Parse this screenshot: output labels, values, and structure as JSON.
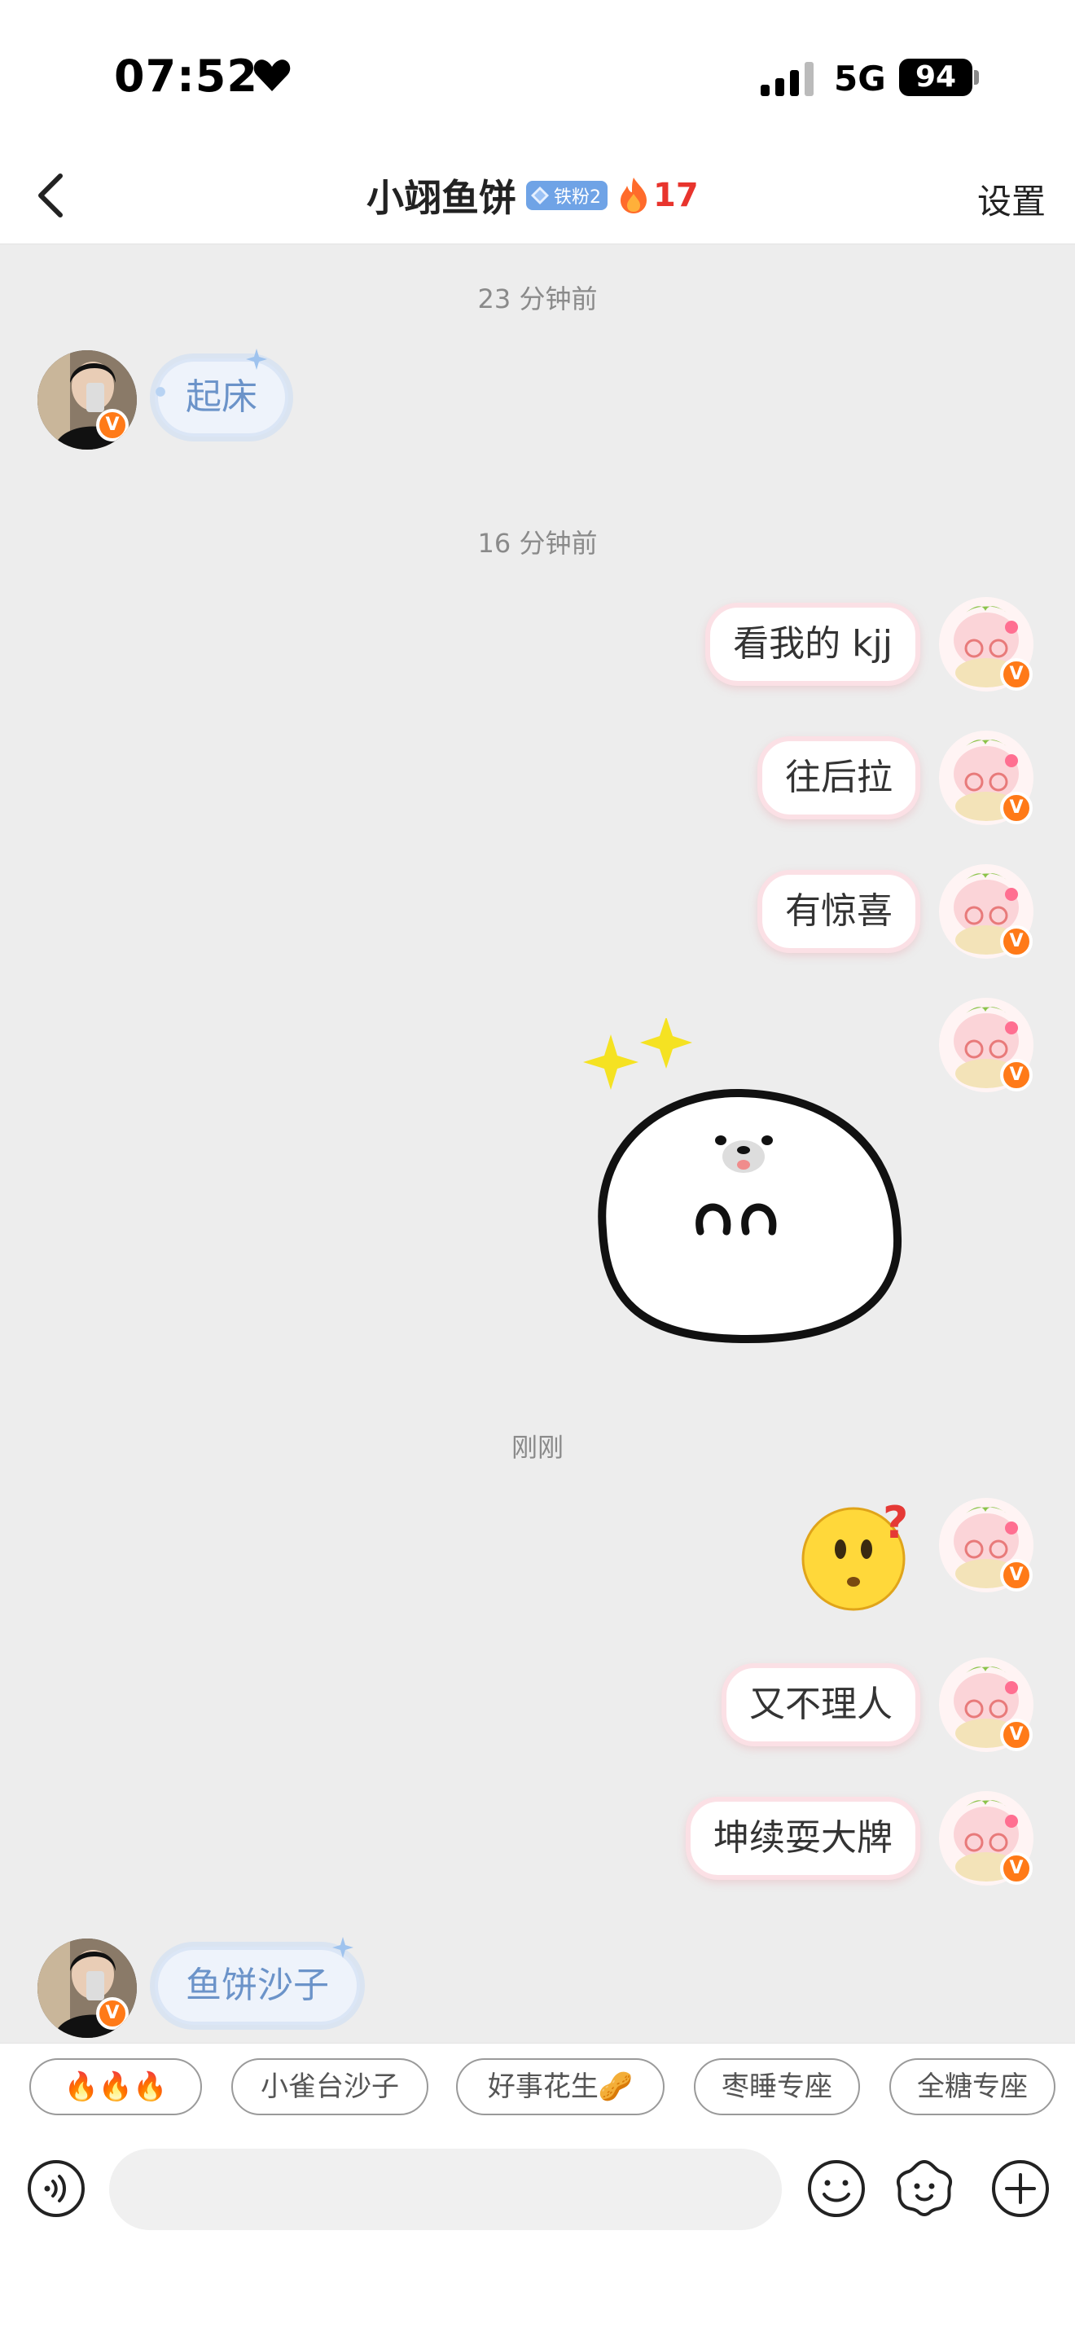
{
  "status_bar": {
    "time": "07:52",
    "network": "5G",
    "battery": "94"
  },
  "header": {
    "title": "小翊鱼饼",
    "fan_badge": "铁粉2",
    "streak": "17",
    "settings_label": "设置"
  },
  "timestamps": [
    "23 分钟前",
    "16 分钟前",
    "刚刚"
  ],
  "messages": {
    "in_1": "起床",
    "out_1": "看我的 kjj",
    "out_2": "往后拉",
    "out_3": "有惊喜",
    "out_4": "又不理人",
    "out_5": "坤续耍大牌",
    "in_2": "鱼饼沙子"
  },
  "quick_replies": [
    "🔥🔥🔥",
    "小雀台沙子",
    "好事花生🥜",
    "枣睡专座",
    "全糖专座"
  ],
  "input": {
    "placeholder": ""
  },
  "colors": {
    "accent_fire": "#e8342d",
    "badge_blue": "#6fa3e6",
    "verified_orange": "#ff7a18"
  },
  "icons": [
    "back-arrow-icon",
    "heart-icon",
    "signal-icon",
    "fire-icon",
    "gem-icon",
    "voice-icon",
    "emoji-icon",
    "sticker-icon",
    "plus-icon"
  ]
}
